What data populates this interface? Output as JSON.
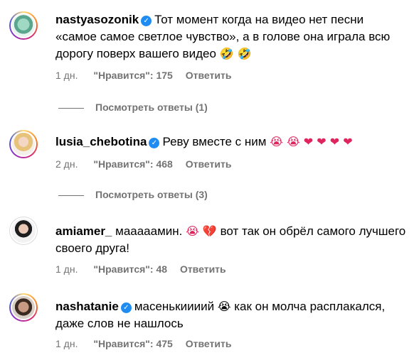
{
  "comments": [
    {
      "username": "nastyasozonik",
      "verified": true,
      "text": "Тот момент когда на видео нет песни «самое самое светлое чувство», а в голове она играла всю дорогу поверх вашего видео",
      "emojis": "🤣 🤣",
      "time": "1 дн.",
      "likes": "\"Нравится\": 175",
      "reply_label": "Ответить",
      "view_replies": "Посмотреть ответы (1)"
    },
    {
      "username": "lusia_chebotina",
      "verified": true,
      "text": "Реву вместе с ним",
      "emojis": "😭 😭 ❤ ❤ ❤ ❤",
      "time": "2 дн.",
      "likes": "\"Нравится\": 468",
      "reply_label": "Ответить",
      "view_replies": "Посмотреть ответы (3)"
    },
    {
      "username": "amiamer_",
      "verified": false,
      "text_before": "мааааамин.",
      "emojis": "😭 💔",
      "text_after": "вот так он обрёл самого лучшего своего друга!",
      "time": "1 дн.",
      "likes": "\"Нравится\": 48",
      "reply_label": "Ответить"
    },
    {
      "username": "nashatanie",
      "verified": true,
      "text_before": "масенькиииий",
      "emojis": "😭",
      "text_after": "как он молча расплакался, даже слов не нашлось",
      "time": "1 дн.",
      "likes": "\"Нравится\": 475",
      "reply_label": "Ответить"
    }
  ]
}
